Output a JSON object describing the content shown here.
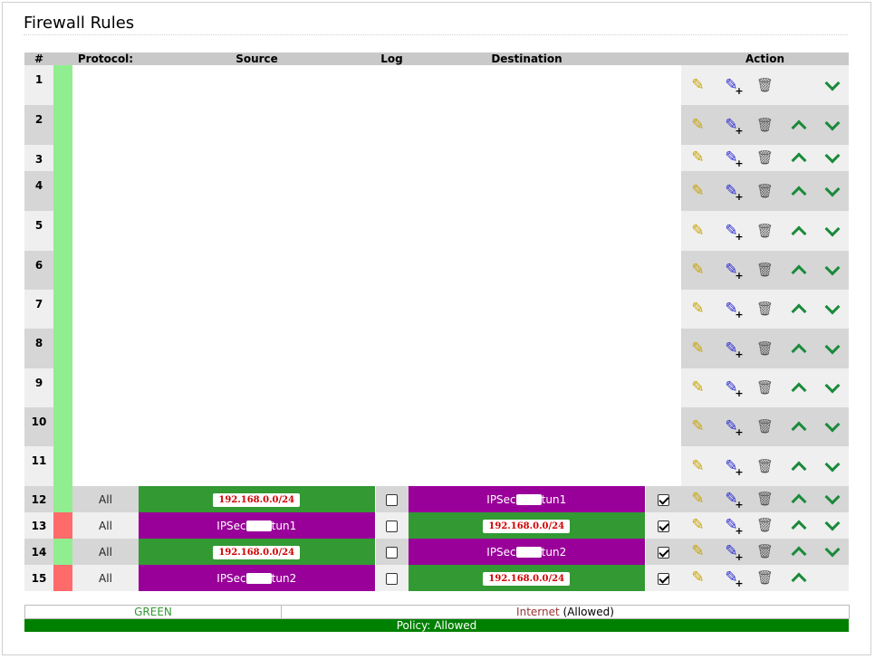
{
  "page": {
    "title": "Firewall Rules"
  },
  "columns": {
    "num": "#",
    "protocol": "Protocol:",
    "source": "Source",
    "log": "Log",
    "destination": "Destination",
    "action": "Action"
  },
  "rows": [
    {
      "num": "1",
      "status": "green",
      "blank": true,
      "up": false,
      "down": true
    },
    {
      "num": "2",
      "status": "green",
      "blank": true,
      "up": true,
      "down": true
    },
    {
      "num": "3",
      "status": "green",
      "blank": true,
      "up": true,
      "down": true
    },
    {
      "num": "4",
      "status": "green",
      "blank": true,
      "up": true,
      "down": true
    },
    {
      "num": "5",
      "status": "green",
      "blank": true,
      "up": true,
      "down": true
    },
    {
      "num": "6",
      "status": "green",
      "blank": true,
      "up": true,
      "down": true
    },
    {
      "num": "7",
      "status": "green",
      "blank": true,
      "up": true,
      "down": true
    },
    {
      "num": "8",
      "status": "green",
      "blank": true,
      "up": true,
      "down": true
    },
    {
      "num": "9",
      "status": "green",
      "blank": true,
      "up": true,
      "down": true
    },
    {
      "num": "10",
      "status": "green",
      "blank": true,
      "up": true,
      "down": true
    },
    {
      "num": "11",
      "status": "green",
      "blank": true,
      "up": true,
      "down": true
    },
    {
      "num": "12",
      "status": "green",
      "protocol": "All",
      "source": {
        "type": "ip",
        "color": "green",
        "text": "192.168.0.0/24"
      },
      "log": false,
      "destination": {
        "type": "ipsec",
        "color": "purple",
        "pre": "IPSec",
        "post": "tun1"
      },
      "dest_log": true,
      "up": true,
      "down": true
    },
    {
      "num": "13",
      "status": "red",
      "protocol": "All",
      "source": {
        "type": "ipsec",
        "color": "purple",
        "pre": "IPSec",
        "post": "tun1"
      },
      "log": false,
      "destination": {
        "type": "ip",
        "color": "green",
        "text": "192.168.0.0/24"
      },
      "dest_log": true,
      "up": true,
      "down": true
    },
    {
      "num": "14",
      "status": "green",
      "protocol": "All",
      "source": {
        "type": "ip",
        "color": "green",
        "text": "192.168.0.0/24"
      },
      "log": false,
      "destination": {
        "type": "ipsec",
        "color": "purple",
        "pre": "IPSec",
        "post": "tun2"
      },
      "dest_log": true,
      "up": true,
      "down": true
    },
    {
      "num": "15",
      "status": "red",
      "protocol": "All",
      "source": {
        "type": "ipsec",
        "color": "purple",
        "pre": "IPSec",
        "post": "tun2"
      },
      "log": false,
      "destination": {
        "type": "ip",
        "color": "green",
        "text": "192.168.0.0/24"
      },
      "dest_log": true,
      "up": true,
      "down": false
    }
  ],
  "policy": {
    "green": "GREEN",
    "internet": "Internet",
    "internet_state": "(Allowed)",
    "bar": "Policy: Allowed"
  },
  "colors": {
    "status_green": "#90ee90",
    "status_red": "#ff6b6b",
    "zone_green": "#339933",
    "zone_purple": "#990099",
    "ip_text": "#d00000",
    "policy_bar": "#008000"
  },
  "icons": {
    "edit": "pencil-icon",
    "copy": "pencil-add-icon",
    "delete": "trash-icon",
    "move_up": "chevron-up-icon",
    "move_down": "chevron-down-icon"
  }
}
